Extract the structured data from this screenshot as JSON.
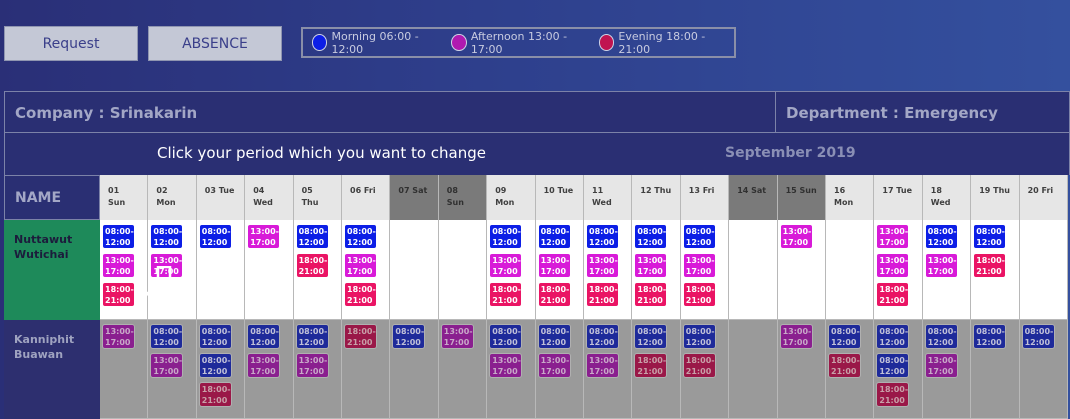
{
  "toolbar": {
    "request_label": "Request",
    "absence_label": "ABSENCE"
  },
  "legend": [
    {
      "label": "Morning 06:00 - 12:00",
      "color": "#0c1ee6"
    },
    {
      "label": "Afternoon 13:00 - 17:00",
      "color": "#d81ad8"
    },
    {
      "label": "Evening 18:00 - 21:00",
      "color": "#ea1464"
    }
  ],
  "header": {
    "company": "Company : Srinakarin",
    "department": "Department : Emergency",
    "instruction": "Click your period which you want to change",
    "month": "September 2019",
    "name_col": "NAME"
  },
  "shift_labels": {
    "m": "08:00-12:00",
    "a": "13:00-17:00",
    "e": "18:00-21:00"
  },
  "days": [
    {
      "num": "01",
      "dow": "Sun",
      "weekend": false
    },
    {
      "num": "02",
      "dow": "Mon",
      "weekend": false
    },
    {
      "num": "03 Tue",
      "dow": "",
      "weekend": false
    },
    {
      "num": "04",
      "dow": "Wed",
      "weekend": false
    },
    {
      "num": "05",
      "dow": "Thu",
      "weekend": false
    },
    {
      "num": "06 Fri",
      "dow": "",
      "weekend": false
    },
    {
      "num": "07 Sat",
      "dow": "",
      "weekend": true
    },
    {
      "num": "08",
      "dow": "Sun",
      "weekend": true
    },
    {
      "num": "09",
      "dow": "Mon",
      "weekend": false
    },
    {
      "num": "10 Tue",
      "dow": "",
      "weekend": false
    },
    {
      "num": "11",
      "dow": "Wed",
      "weekend": false
    },
    {
      "num": "12 Thu",
      "dow": "",
      "weekend": false
    },
    {
      "num": "13 Fri",
      "dow": "",
      "weekend": false
    },
    {
      "num": "14 Sat",
      "dow": "",
      "weekend": true
    },
    {
      "num": "15 Sun",
      "dow": "",
      "weekend": true
    },
    {
      "num": "16",
      "dow": "Mon",
      "weekend": false
    },
    {
      "num": "17 Tue",
      "dow": "",
      "weekend": false
    },
    {
      "num": "18",
      "dow": "Wed",
      "weekend": false
    },
    {
      "num": "19 Thu",
      "dow": "",
      "weekend": false
    },
    {
      "num": "20 Fri",
      "dow": "",
      "weekend": false
    }
  ],
  "employees": [
    {
      "name": "Nuttawut Wutichai",
      "shifts": [
        [
          "m",
          "a",
          "e"
        ],
        [
          "m",
          "a"
        ],
        [
          "m"
        ],
        [
          "a"
        ],
        [
          "m",
          "e"
        ],
        [
          "m",
          "a",
          "e"
        ],
        [],
        [],
        [
          "m",
          "a",
          "e"
        ],
        [
          "m",
          "a",
          "e"
        ],
        [
          "m",
          "a",
          "e"
        ],
        [
          "m",
          "a",
          "e"
        ],
        [
          "m",
          "a",
          "e"
        ],
        [],
        [
          "a"
        ],
        [],
        [
          "a",
          "a",
          "e"
        ],
        [
          "m",
          "a"
        ],
        [
          "m",
          "e"
        ],
        []
      ]
    },
    {
      "name": "Kanniphit Buawan",
      "shifts": [
        [
          "a"
        ],
        [
          "m",
          "a"
        ],
        [
          "m",
          "m",
          "e"
        ],
        [
          "m",
          "a"
        ],
        [
          "m",
          "a"
        ],
        [
          "e"
        ],
        [
          "m"
        ],
        [
          "a"
        ],
        [
          "m",
          "a"
        ],
        [
          "m",
          "a"
        ],
        [
          "m",
          "a"
        ],
        [
          "m",
          "e"
        ],
        [
          "m",
          "e"
        ],
        [],
        [
          "a"
        ],
        [
          "m",
          "e"
        ],
        [
          "m",
          "m",
          "e"
        ],
        [
          "m",
          "a"
        ],
        [
          "m"
        ],
        [
          "m"
        ]
      ]
    }
  ]
}
